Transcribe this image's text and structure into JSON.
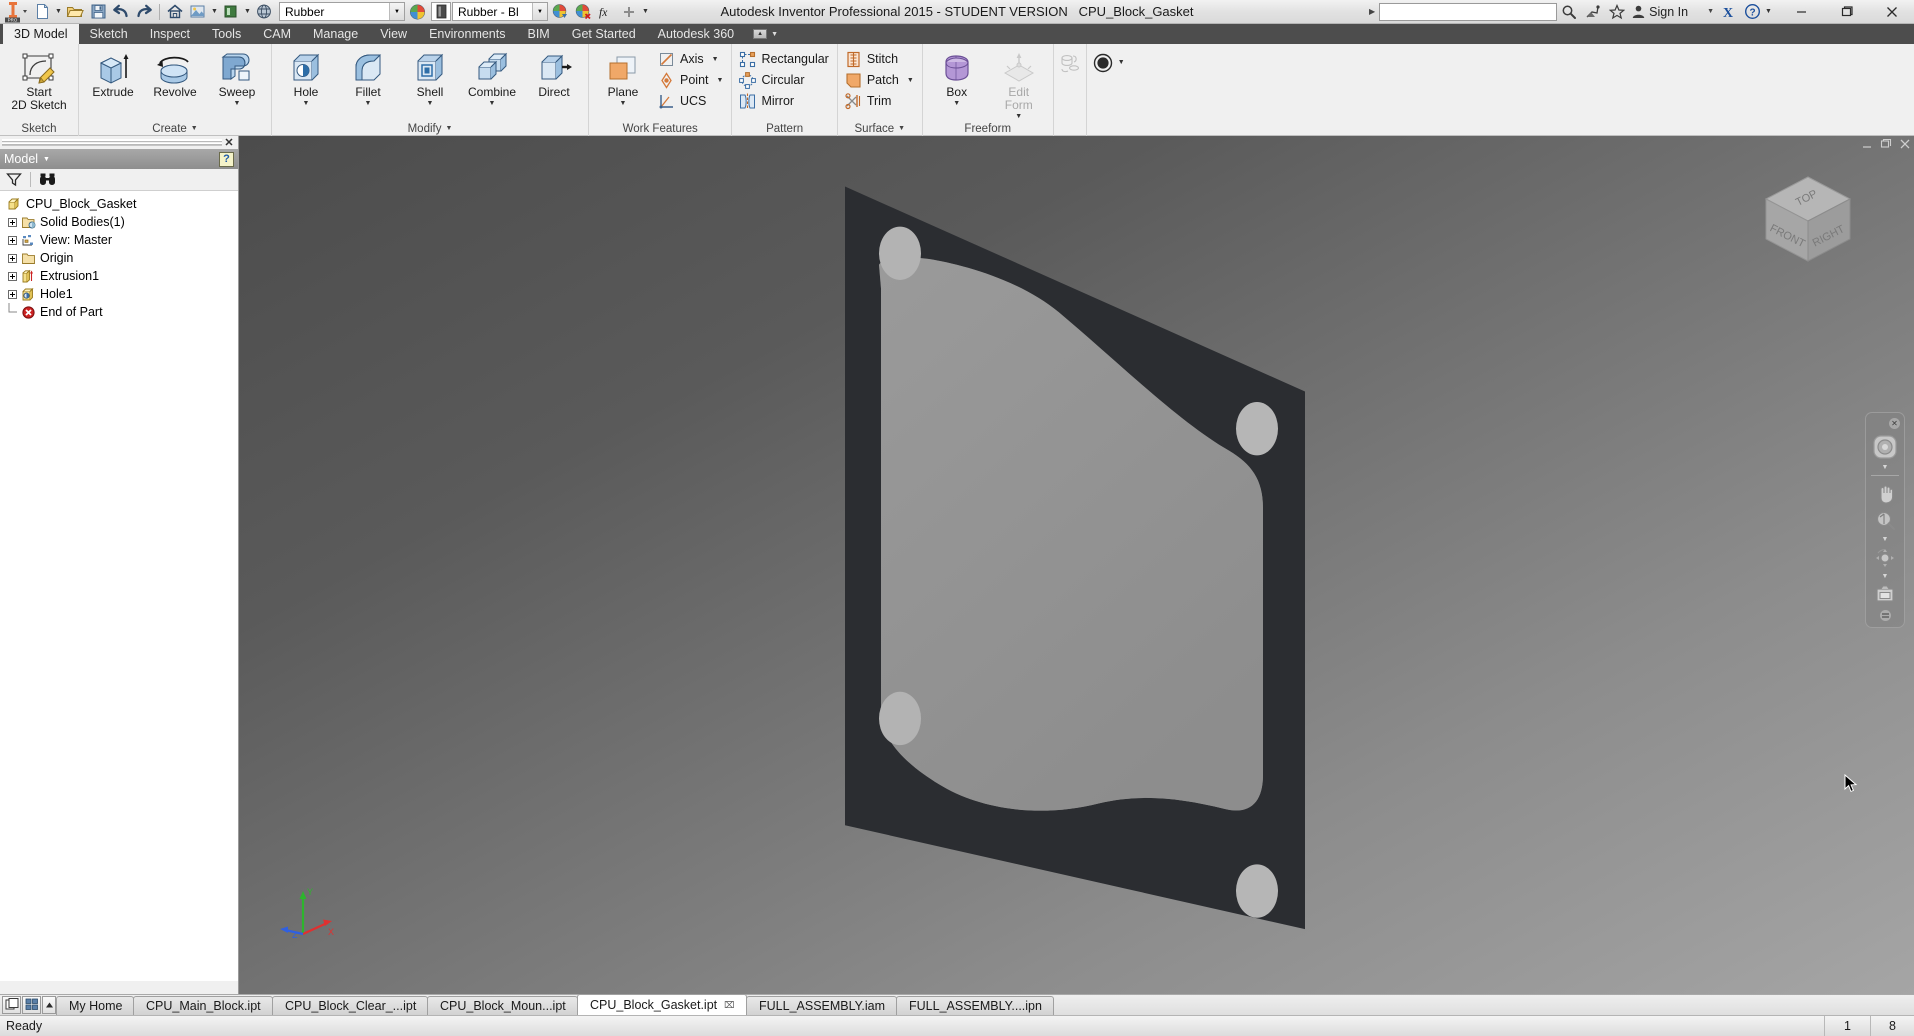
{
  "window": {
    "title": "Autodesk Inventor Professional 2015 - STUDENT VERSION",
    "document_name": "CPU_Block_Gasket",
    "minimize": "–",
    "restore": "❐",
    "close": "✕"
  },
  "quick_access": {
    "logo": "inventor-pro-logo",
    "buttons": [
      {
        "name": "new-document",
        "icon": "new-file-icon",
        "has_dropdown": true
      },
      {
        "name": "open-document",
        "icon": "open-folder-icon",
        "has_dropdown": false
      },
      {
        "name": "save-document",
        "icon": "save-disk-icon",
        "has_dropdown": false
      },
      {
        "name": "undo",
        "icon": "undo-arrow-icon",
        "has_dropdown": false
      },
      {
        "name": "redo",
        "icon": "redo-arrow-icon",
        "has_dropdown": false
      },
      {
        "name": "home-view",
        "icon": "home-icon",
        "has_dropdown": false
      },
      {
        "name": "appearance",
        "icon": "appearance-sphere-icon",
        "has_dropdown": true
      },
      {
        "name": "material",
        "icon": "material-cylinder-icon",
        "has_dropdown": true
      },
      {
        "name": "visual-style",
        "icon": "globe-icon",
        "has_dropdown": false
      }
    ],
    "appearance_value": "Rubber",
    "material_value": "Rubber - Bl",
    "after_buttons": [
      {
        "name": "adjust-appearance",
        "icon": "appearance-adjust-icon"
      },
      {
        "name": "clear-appearance-override",
        "icon": "appearance-clear-icon"
      },
      {
        "name": "parameters",
        "icon": "fx-parameters-icon"
      },
      {
        "name": "customize-qat",
        "icon": "plus-icon"
      }
    ]
  },
  "title_right": {
    "search_placeholder": "",
    "search_value": "",
    "icons": [
      {
        "name": "search-magnifier-icon"
      },
      {
        "name": "satellite-dish-icon"
      },
      {
        "name": "favorites-star-icon"
      }
    ],
    "sign_in_label": "Sign In",
    "exchange_label": "X",
    "help_label": "?"
  },
  "ribbon": {
    "tabs": [
      {
        "label": "3D Model",
        "active": true
      },
      {
        "label": "Sketch",
        "active": false
      },
      {
        "label": "Inspect",
        "active": false
      },
      {
        "label": "Tools",
        "active": false
      },
      {
        "label": "CAM",
        "active": false
      },
      {
        "label": "Manage",
        "active": false
      },
      {
        "label": "View",
        "active": false
      },
      {
        "label": "Environments",
        "active": false
      },
      {
        "label": "BIM",
        "active": false
      },
      {
        "label": "Get Started",
        "active": false
      },
      {
        "label": "Autodesk 360",
        "active": false
      }
    ],
    "panels": [
      {
        "title": "Sketch",
        "has_dropdown": false,
        "big_buttons": [
          {
            "name": "start-2d-sketch-button",
            "icon": "sketch-pencil-icon",
            "line1": "Start",
            "line2": "2D Sketch",
            "dropdown": true,
            "disabled": false
          }
        ]
      },
      {
        "title": "Create",
        "has_dropdown": true,
        "big_buttons": [
          {
            "name": "extrude-button",
            "icon": "extrude-icon",
            "line1": "Extrude",
            "line2": "",
            "dropdown": false,
            "disabled": false
          },
          {
            "name": "revolve-button",
            "icon": "revolve-icon",
            "line1": "Revolve",
            "line2": "",
            "dropdown": false,
            "disabled": false
          },
          {
            "name": "sweep-button",
            "icon": "sweep-icon",
            "line1": "Sweep",
            "line2": "",
            "dropdown": true,
            "disabled": false
          }
        ]
      },
      {
        "title": "Modify",
        "has_dropdown": true,
        "big_buttons": [
          {
            "name": "hole-button",
            "icon": "hole-icon",
            "line1": "Hole",
            "line2": "",
            "dropdown": true,
            "disabled": false
          },
          {
            "name": "fillet-button",
            "icon": "fillet-icon",
            "line1": "Fillet",
            "line2": "",
            "dropdown": true,
            "disabled": false
          },
          {
            "name": "shell-button",
            "icon": "shell-icon",
            "line1": "Shell",
            "line2": "",
            "dropdown": true,
            "disabled": false
          },
          {
            "name": "combine-button",
            "icon": "combine-icon",
            "line1": "Combine",
            "line2": "",
            "dropdown": true,
            "disabled": false
          },
          {
            "name": "direct-button",
            "icon": "direct-edit-icon",
            "line1": "Direct",
            "line2": "",
            "dropdown": false,
            "disabled": false
          }
        ]
      },
      {
        "title": "Work Features",
        "has_dropdown": false,
        "big_buttons": [
          {
            "name": "plane-button",
            "icon": "work-plane-icon",
            "line1": "Plane",
            "line2": "",
            "dropdown": true,
            "disabled": false
          }
        ],
        "small_buttons": [
          {
            "name": "axis-button",
            "icon": "work-axis-icon",
            "label": "Axis",
            "dropdown": true
          },
          {
            "name": "point-button",
            "icon": "work-point-icon",
            "label": "Point",
            "dropdown": true
          },
          {
            "name": "ucs-button",
            "icon": "ucs-icon",
            "label": "UCS",
            "dropdown": false
          }
        ]
      },
      {
        "title": "Pattern",
        "has_dropdown": false,
        "small_buttons": [
          {
            "name": "rectangular-pattern-button",
            "icon": "rectangular-pattern-icon",
            "label": "Rectangular",
            "dropdown": false
          },
          {
            "name": "circular-pattern-button",
            "icon": "circular-pattern-icon",
            "label": "Circular",
            "dropdown": false
          },
          {
            "name": "mirror-button",
            "icon": "mirror-icon",
            "label": "Mirror",
            "dropdown": false
          }
        ]
      },
      {
        "title": "Surface",
        "has_dropdown": true,
        "small_buttons": [
          {
            "name": "stitch-button",
            "icon": "stitch-icon",
            "label": "Stitch",
            "dropdown": false
          },
          {
            "name": "patch-button",
            "icon": "patch-icon",
            "label": "Patch",
            "dropdown": true
          },
          {
            "name": "trim-button",
            "icon": "trim-scissors-icon",
            "label": "Trim",
            "dropdown": false
          }
        ]
      },
      {
        "title": "Freeform",
        "has_dropdown": false,
        "big_buttons": [
          {
            "name": "box-button",
            "icon": "freeform-box-icon",
            "line1": "Box",
            "line2": "",
            "dropdown": true,
            "disabled": false
          },
          {
            "name": "edit-form-button",
            "icon": "edit-form-icon",
            "line1": "Edit",
            "line2": "Form",
            "dropdown": true,
            "disabled": true
          }
        ]
      },
      {
        "title": "",
        "has_dropdown": false,
        "tiny_buttons": [
          {
            "name": "convert-to-sheet-metal-button",
            "icon": "convert-icon",
            "disabled": true
          },
          {
            "name": "visual-style-button",
            "icon": "visual-style-sphere-icon",
            "disabled": false,
            "dropdown": true
          }
        ]
      }
    ]
  },
  "browser": {
    "panel_title": "Model",
    "help_label": "?",
    "toolbar": [
      {
        "name": "filter-button",
        "icon": "filter-funnel-icon"
      },
      {
        "name": "find-button",
        "icon": "binoculars-icon"
      }
    ],
    "tree": [
      {
        "label": "CPU_Block_Gasket",
        "icon": "part-cube-icon",
        "indent": 0,
        "expandable": false,
        "root": true
      },
      {
        "label": "Solid Bodies(1)",
        "icon": "solid-bodies-folder-icon",
        "indent": 1,
        "expandable": true,
        "root": false
      },
      {
        "label": "View: Master",
        "icon": "view-master-icon",
        "indent": 1,
        "expandable": true,
        "root": false
      },
      {
        "label": "Origin",
        "icon": "origin-folder-icon",
        "indent": 1,
        "expandable": true,
        "root": false
      },
      {
        "label": "Extrusion1",
        "icon": "extrusion-feature-icon",
        "indent": 1,
        "expandable": true,
        "root": false
      },
      {
        "label": "Hole1",
        "icon": "hole-feature-icon",
        "indent": 1,
        "expandable": true,
        "root": false
      },
      {
        "label": "End of Part",
        "icon": "end-of-part-icon",
        "indent": 1,
        "expandable": false,
        "root": false
      }
    ]
  },
  "viewport": {
    "viewcube": {
      "top_label": "TOP",
      "front_label": "FRONT",
      "right_label": "RIGHT"
    },
    "nav_bar": [
      {
        "name": "full-navigation-wheel-button",
        "icon": "steering-wheel-icon",
        "dropdown": true
      },
      {
        "name": "pan-button",
        "icon": "pan-hand-icon",
        "dropdown": false
      },
      {
        "name": "zoom-button",
        "icon": "zoom-magnifier-icon",
        "dropdown": true
      },
      {
        "name": "orbit-button",
        "icon": "orbit-icon",
        "dropdown": true
      },
      {
        "name": "look-at-button",
        "icon": "look-at-camera-icon",
        "dropdown": false
      }
    ],
    "nav_close": "✕",
    "axis_labels": {
      "x": "X",
      "y": "Y",
      "z": "Z"
    },
    "window_buttons": {
      "minimize": "–",
      "restore": "❐",
      "close": "✕"
    },
    "model_colors": {
      "part_dark": "#2b2d31",
      "inner_face": "#8a8a8a",
      "background_top": "#4c4c4c",
      "background_bottom": "#a5a5a5"
    }
  },
  "document_tabs": {
    "nav_buttons": [
      {
        "name": "tile-windows-button",
        "icon": "tile-windows-icon"
      },
      {
        "name": "cascade-windows-button",
        "icon": "grid-windows-icon"
      },
      {
        "name": "tab-scroll-up-button",
        "icon": "caret-up-icon"
      }
    ],
    "tabs": [
      {
        "label": "My Home",
        "active": false,
        "closable": false
      },
      {
        "label": "CPU_Main_Block.ipt",
        "active": false,
        "closable": false
      },
      {
        "label": "CPU_Block_Clear_...ipt",
        "active": false,
        "closable": false
      },
      {
        "label": "CPU_Block_Moun...ipt",
        "active": false,
        "closable": false
      },
      {
        "label": "CPU_Block_Gasket.ipt",
        "active": true,
        "closable": true
      },
      {
        "label": "FULL_ASSEMBLY.iam",
        "active": false,
        "closable": false
      },
      {
        "label": "FULL_ASSEMBLY....ipn",
        "active": false,
        "closable": false
      }
    ],
    "close_glyph": "⌧"
  },
  "status_bar": {
    "message": "Ready",
    "cells": [
      "1",
      "8"
    ]
  }
}
